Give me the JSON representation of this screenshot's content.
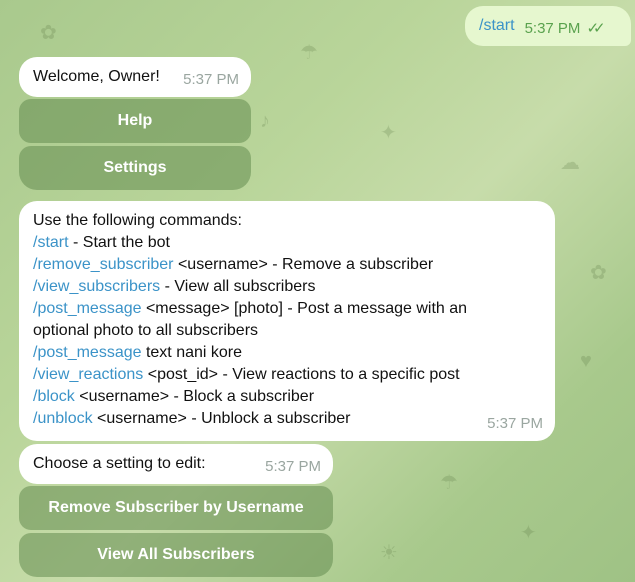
{
  "outgoing": {
    "text": "/start",
    "time": "5:37 PM",
    "checks": "✓✓"
  },
  "welcome": {
    "text": "Welcome, Owner!",
    "time": "5:37 PM"
  },
  "keyboard1": {
    "help_label": "Help",
    "settings_label": "Settings"
  },
  "commands": {
    "intro": "Use the following commands:",
    "items": [
      {
        "cmd": "/start",
        "desc": " - Start the bot"
      },
      {
        "cmd": "/remove_subscriber",
        "desc": " <username> - Remove a subscriber"
      },
      {
        "cmd": "/view_subscribers",
        "desc": " - View all subscribers"
      },
      {
        "cmd": "/post_message",
        "desc": " <message> [photo] - Post a message with an"
      },
      {
        "cmd": "",
        "desc": "optional photo to all subscribers"
      },
      {
        "cmd": "/post_message",
        "desc": " text nani kore"
      },
      {
        "cmd": "/view_reactions",
        "desc": " <post_id> - View reactions to a specific post"
      },
      {
        "cmd": "/block",
        "desc": " <username> - Block a subscriber"
      },
      {
        "cmd": "/unblock",
        "desc": " <username> - Unblock a subscriber"
      }
    ],
    "time": "5:37 PM"
  },
  "settings_prompt": {
    "text": "Choose a setting to edit:",
    "time": "5:37 PM"
  },
  "keyboard2": {
    "remove_label": "Remove Subscriber by Username",
    "view_label": "View All Subscribers"
  },
  "colors": {
    "link": "#3b93c8",
    "outgoing_bubble": "#e6f7cf",
    "keyboard_button": "rgba(100,140,80,0.55)"
  }
}
